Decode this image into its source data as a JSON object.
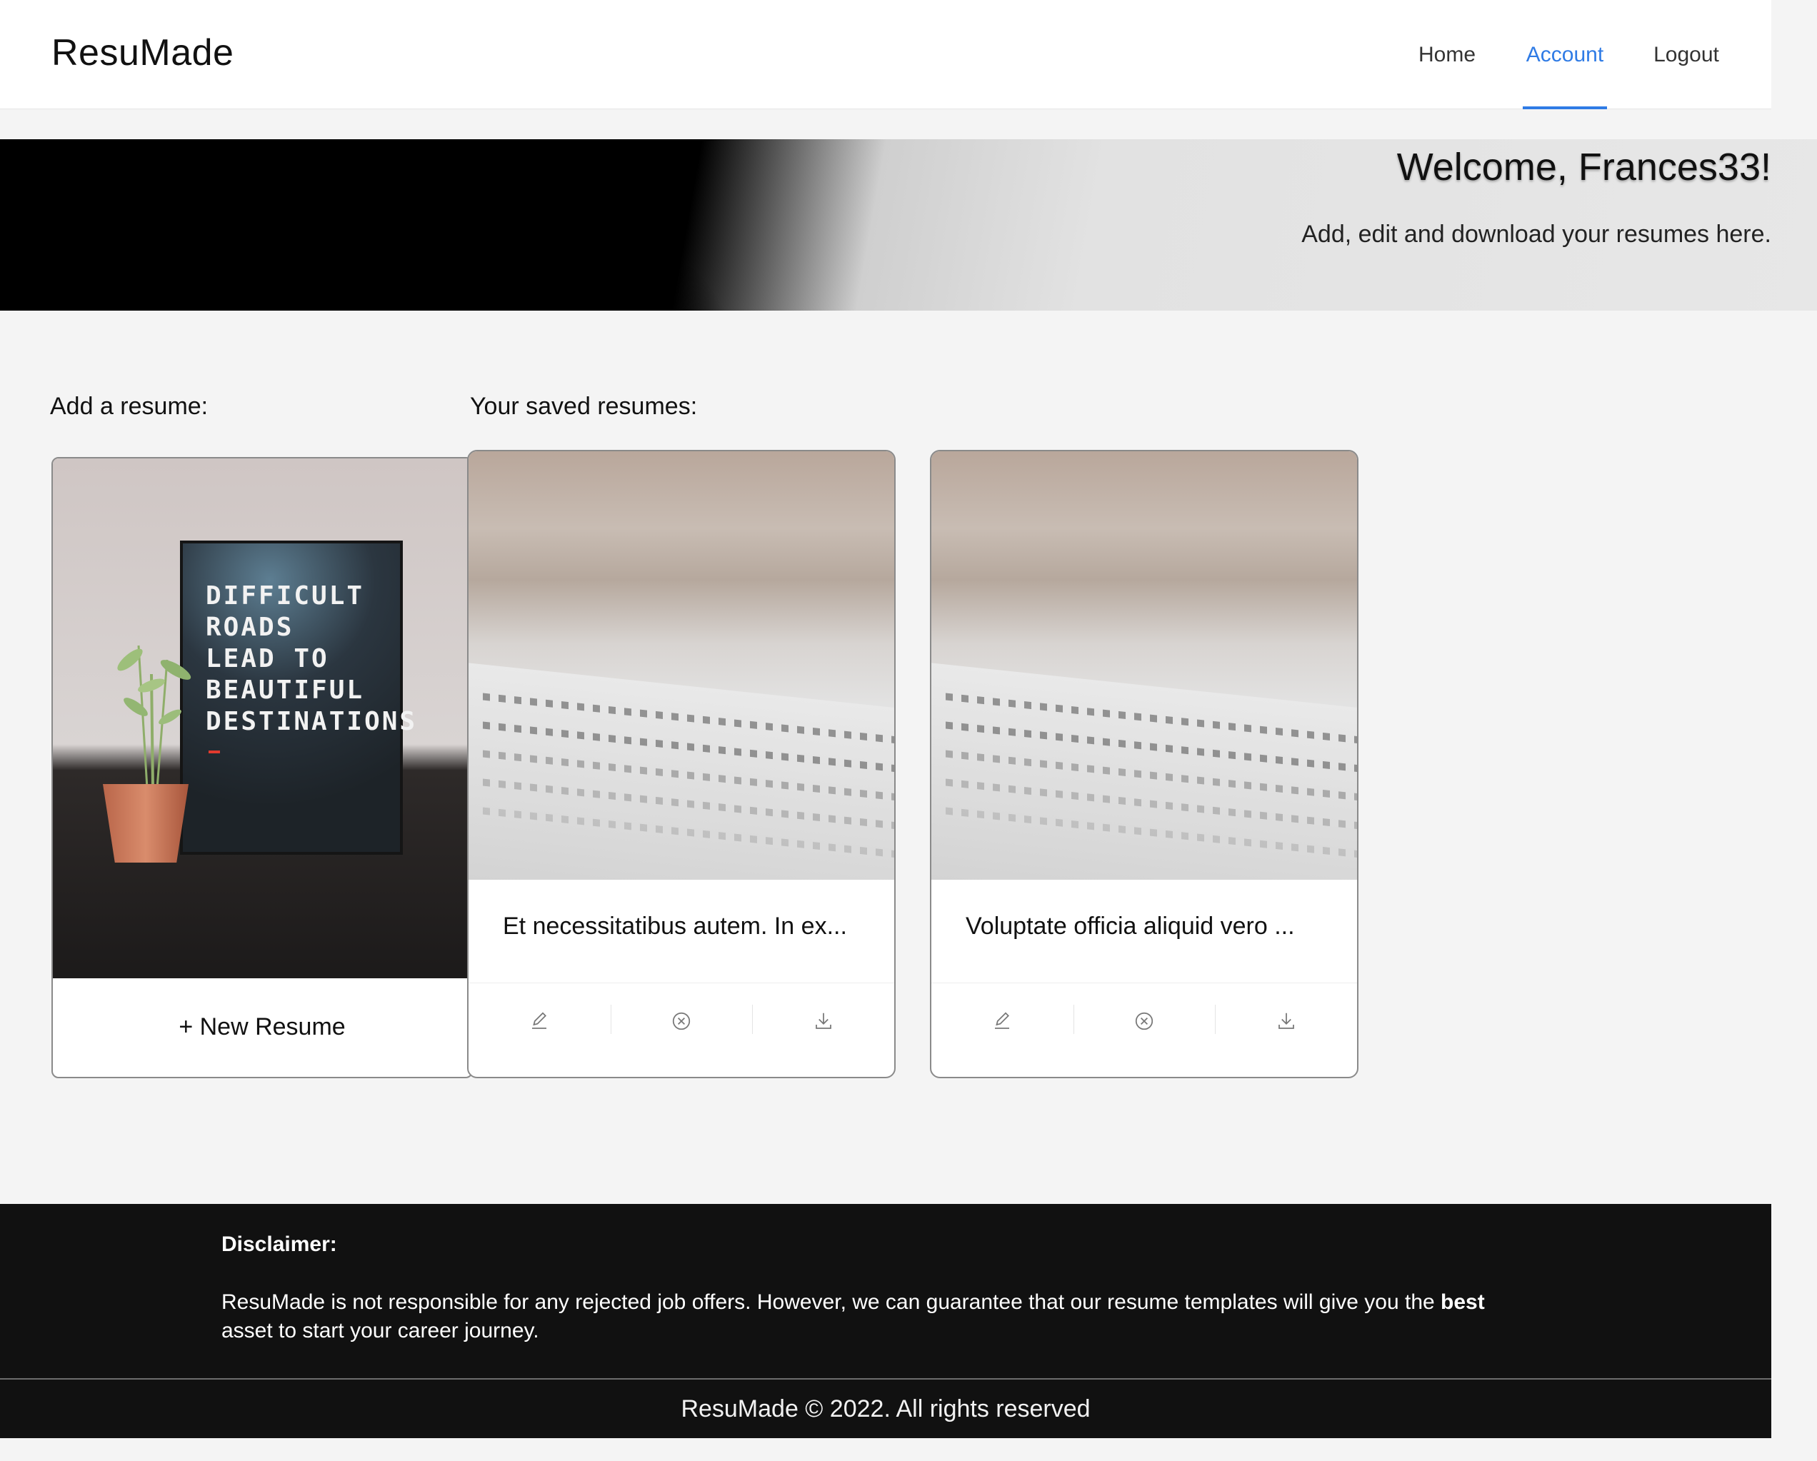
{
  "app": {
    "logo": "ResuMade"
  },
  "nav": {
    "items": [
      {
        "label": "Home"
      },
      {
        "label": "Account"
      },
      {
        "label": "Logout"
      }
    ]
  },
  "hero": {
    "title": "Welcome, Frances33!",
    "subtitle": "Add, edit and download your resumes here."
  },
  "sections": {
    "add_label": "Add a resume:",
    "saved_label": "Your saved resumes:"
  },
  "new_resume": {
    "label": "+ New Resume",
    "board_text": "DIFFICULT\nROADS\nLEAD TO\nBEAUTIFUL\nDESTINATIONS"
  },
  "resumes": [
    {
      "title": "Et necessitatibus autem. In ex...",
      "actions": [
        "edit-icon",
        "delete-icon",
        "download-icon"
      ]
    },
    {
      "title": "Voluptate officia aliquid vero ...",
      "actions": [
        "edit-icon",
        "delete-icon",
        "download-icon"
      ]
    }
  ],
  "footer": {
    "disclaimer_title": "Disclaimer:",
    "disclaimer_text_before": "ResuMade is not responsible for any rejected job offers. However, we can guarantee that our resume templates will give you the",
    "disclaimer_bold": "best",
    "disclaimer_text_after": "asset to start your career journey.",
    "copyright": "ResuMade © 2022. All rights reserved"
  },
  "colors": {
    "accent": "#2f7be5",
    "footer_bg": "#111111",
    "page_bg": "#f4f4f4"
  }
}
